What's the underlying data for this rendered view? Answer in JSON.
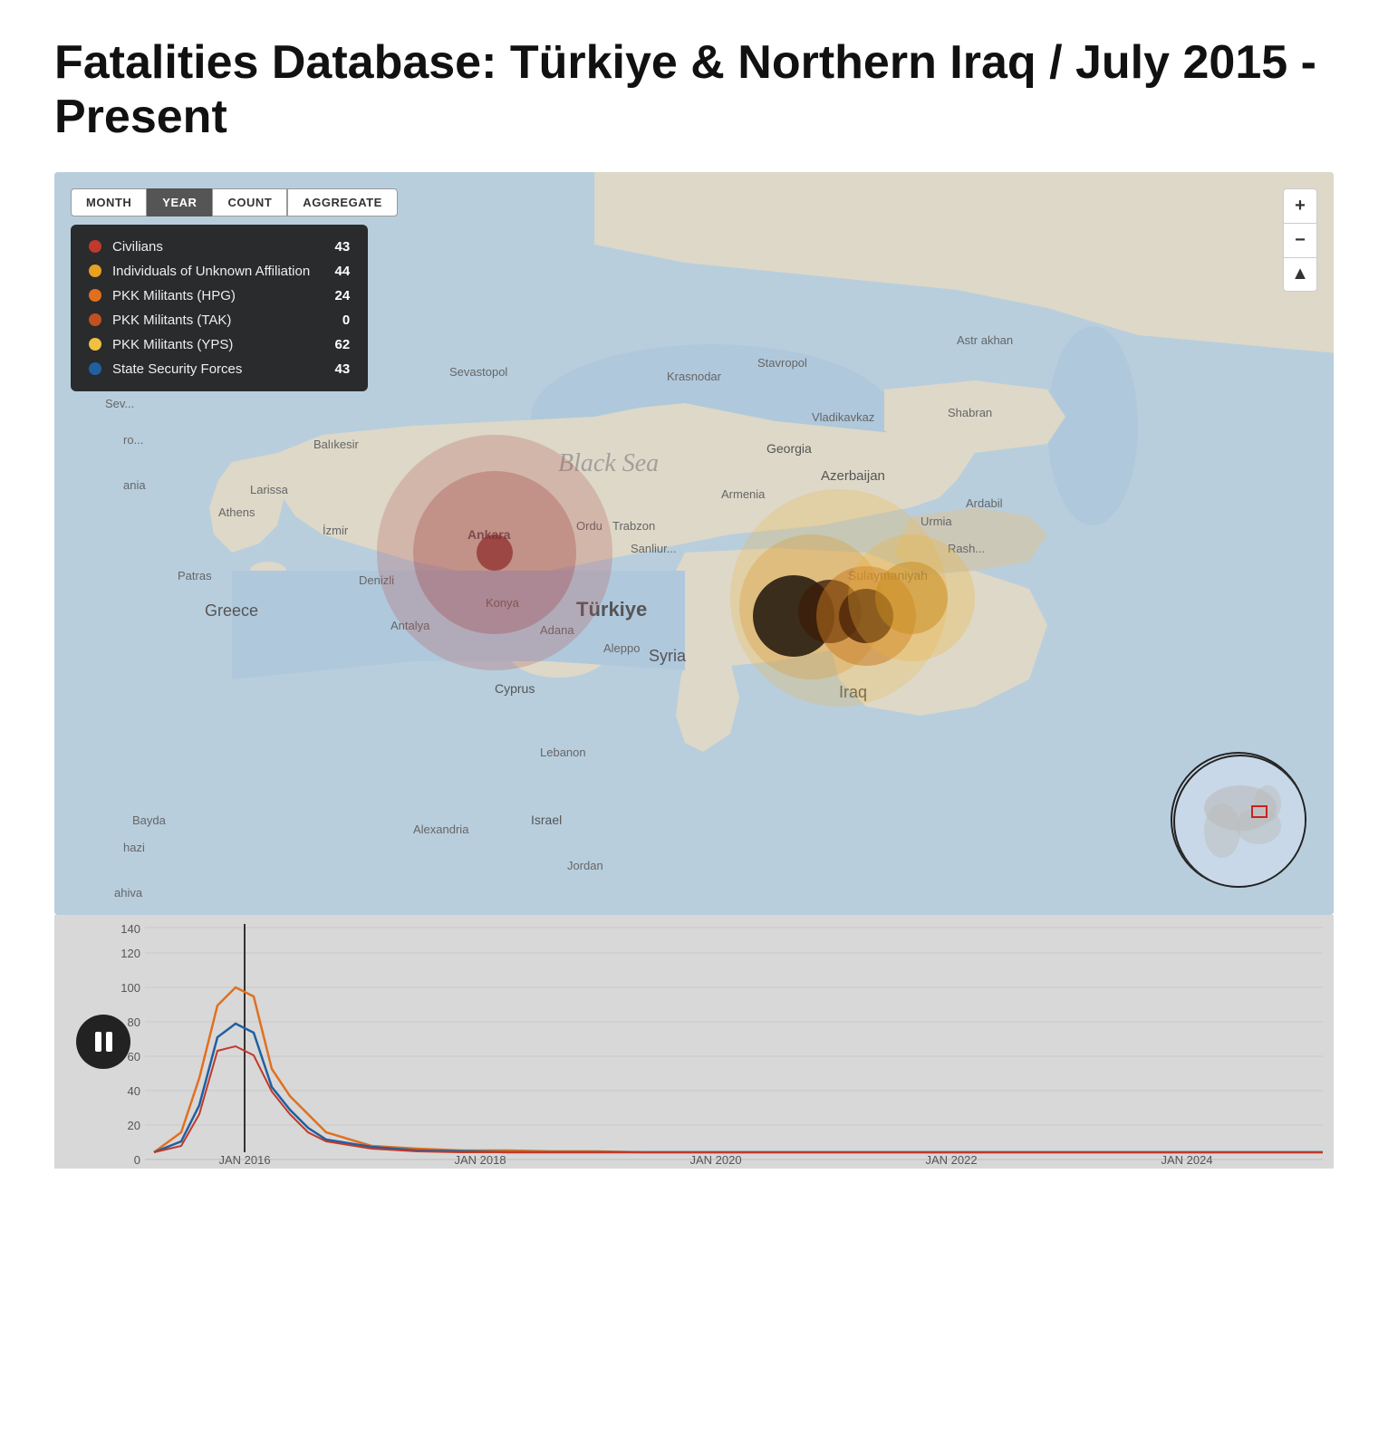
{
  "title": "Fatalities Database: Türkiye & Northern Iraq / July 2015 - Present",
  "toolbar": {
    "buttons": [
      {
        "label": "MONTH",
        "active": false
      },
      {
        "label": "YEAR",
        "active": true
      },
      {
        "label": "COUNT",
        "active": false
      },
      {
        "label": "AGGREGATE",
        "active": false
      }
    ]
  },
  "legend": {
    "items": [
      {
        "label": "Civilians",
        "color": "#c0392b",
        "count": "43"
      },
      {
        "label": "Individuals of Unknown Affiliation",
        "color": "#e8a020",
        "count": "44"
      },
      {
        "label": "PKK Militants (HPG)",
        "color": "#e07020",
        "count": "24"
      },
      {
        "label": "PKK Militants (TAK)",
        "color": "#c05020",
        "count": "0"
      },
      {
        "label": "PKK Militants (YPS)",
        "color": "#f0c040",
        "count": "62"
      },
      {
        "label": "State Security Forces",
        "color": "#2060a0",
        "count": "43"
      }
    ]
  },
  "controls": {
    "zoom_in": "+",
    "zoom_out": "−",
    "reset": "▲"
  },
  "chart": {
    "y_labels": [
      "0",
      "20",
      "40",
      "60",
      "80",
      "100",
      "120",
      "140"
    ],
    "x_labels": [
      "JAN 2016",
      "JAN 2018",
      "JAN 2020",
      "JAN 2022",
      "JAN 2024"
    ]
  },
  "colors": {
    "map_bg": "#b8cedd",
    "land": "#e8e0d0",
    "water": "#b8cedd",
    "accent": "#e07020",
    "chart_bg": "#d8d8d8"
  }
}
